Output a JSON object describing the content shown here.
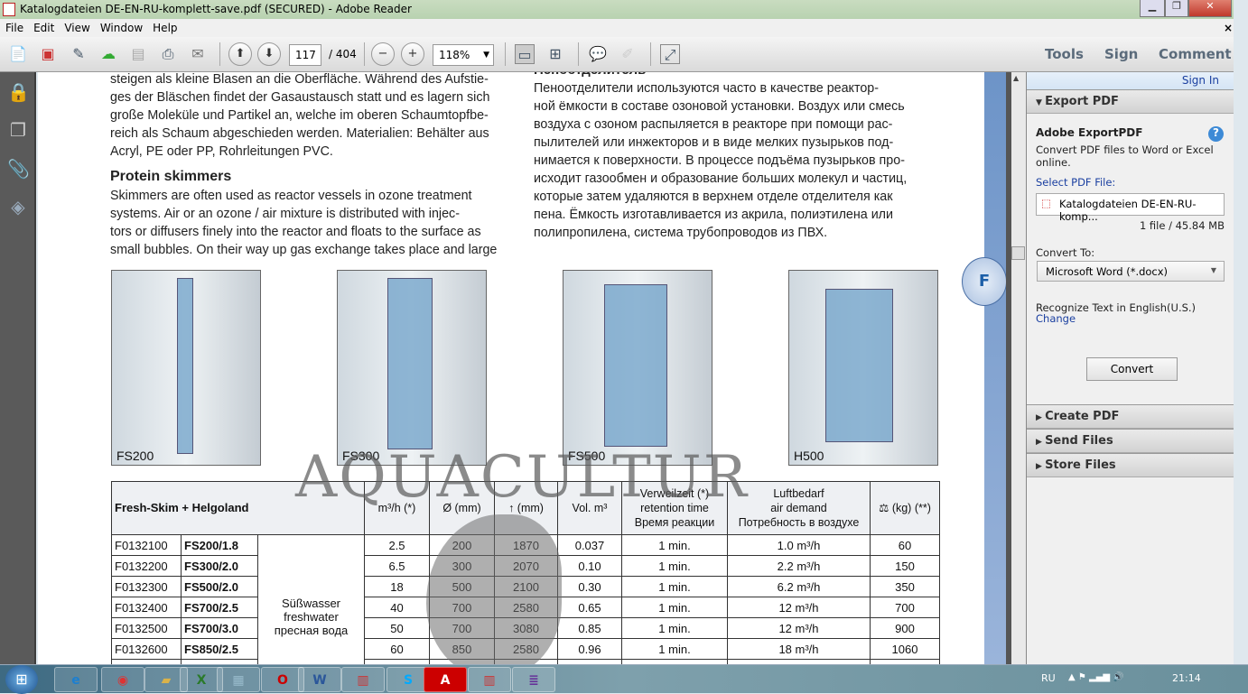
{
  "window": {
    "title": "Katalogdateien DE-EN-RU-komplett-save.pdf (SECURED) - Adobe Reader",
    "close_doc": "×"
  },
  "menu": [
    "File",
    "Edit",
    "View",
    "Window",
    "Help"
  ],
  "toolbar": {
    "page_current": "117",
    "page_total": "/ 404",
    "zoom": "118%",
    "tools": "Tools",
    "sign": "Sign",
    "comment": "Comment"
  },
  "doc": {
    "de_lines": [
      "steigen als kleine Blasen an die Oberfläche. Während des Aufstie-",
      "ges der Bläschen findet der Gasaustausch statt und es lagern sich",
      "große Moleküle und Partikel an, welche im oberen Schaumtopfbe-",
      "reich als Schaum abgeschieden werden. Materialien: Behälter aus",
      "Acryl, PE oder PP, Rohrleitungen PVC."
    ],
    "en_heading": "Protein skimmers",
    "en_lines": [
      "Skimmers are often used as reactor vessels in ozone treatment",
      "systems. Air or an ozone / air mixture is distributed with injec-",
      "tors or diffusers finely into the reactor and floats to the surface as",
      "small bubbles. On their way up gas exchange takes place and large"
    ],
    "ru_heading": "Пеноотделитель",
    "ru_lines": [
      "Пеноотделители используются часто в качестве реактор-",
      "ной ёмкости в составе озоновой установки. Воздух или смесь",
      "воздуха с озоном распыляется в реакторе при помощи рас-",
      "пылителей или инжекторов и в виде мелких пузырьков под-",
      "нимается к поверхности. В процессе подъёма пузырьков про-",
      "исходит газообмен и образование больших молекул и частиц,",
      "которые затем удаляются в верхнем отделе отделителя как",
      "пена. Ёмкость изготавливается из акрила, полиэтилена или",
      "полипропилена, система трубопроводов из ПВХ."
    ],
    "tab_letter": "F",
    "photos": [
      "FS200",
      "FS300",
      "FS500",
      "H500"
    ],
    "watermark": "AQUACULTUR",
    "table": {
      "headers": [
        "Fresh-Skim + Helgoland",
        "m³/h (*)",
        "Ø (mm)",
        "↑ (mm)",
        "Vol. m³",
        "Verweilzeit (*)",
        "retention time",
        "Время реакции",
        "Luftbedarf",
        "air demand",
        "Потребность в воздухе",
        "(kg) (**)"
      ],
      "group": [
        "Süßwasser",
        "freshwater",
        "пресная вода"
      ],
      "rows": [
        [
          "F0132100",
          "FS200/1.8",
          "2.5",
          "200",
          "1870",
          "0.037",
          "1 min.",
          "1.0 m³/h",
          "60"
        ],
        [
          "F0132200",
          "FS300/2.0",
          "6.5",
          "300",
          "2070",
          "0.10",
          "1 min.",
          "2.2 m³/h",
          "150"
        ],
        [
          "F0132300",
          "FS500/2.0",
          "18",
          "500",
          "2100",
          "0.30",
          "1 min.",
          "6.2 m³/h",
          "350"
        ],
        [
          "F0132400",
          "FS700/2.5",
          "40",
          "700",
          "2580",
          "0.65",
          "1 min.",
          "12 m³/h",
          "700"
        ],
        [
          "F0132500",
          "FS700/3.0",
          "50",
          "700",
          "3080",
          "0.85",
          "1 min.",
          "12 m³/h",
          "900"
        ],
        [
          "F0132600",
          "FS850/2.5",
          "60",
          "850",
          "2580",
          "0.96",
          "1 min.",
          "18 m³/h",
          "1060"
        ]
      ]
    }
  },
  "rpane": {
    "sign_in": "Sign In",
    "export_pdf": "Export PDF",
    "adobe_export": "Adobe ExportPDF",
    "desc1": "Convert PDF files to Word or Excel",
    "desc2": "online.",
    "select_file": "Select PDF File:",
    "file_name": "Katalogdateien DE-EN-RU-komp...",
    "file_info": "1 file / 45.84 MB",
    "convert_to": "Convert To:",
    "format": "Microsoft Word (*.docx)",
    "recognize": "Recognize Text in English(U.S.)",
    "change": "Change",
    "convert_btn": "Convert",
    "create_pdf": "Create PDF",
    "send_files": "Send Files",
    "store_files": "Store Files"
  },
  "taskbar": {
    "lang": "RU",
    "time": "21:14"
  }
}
